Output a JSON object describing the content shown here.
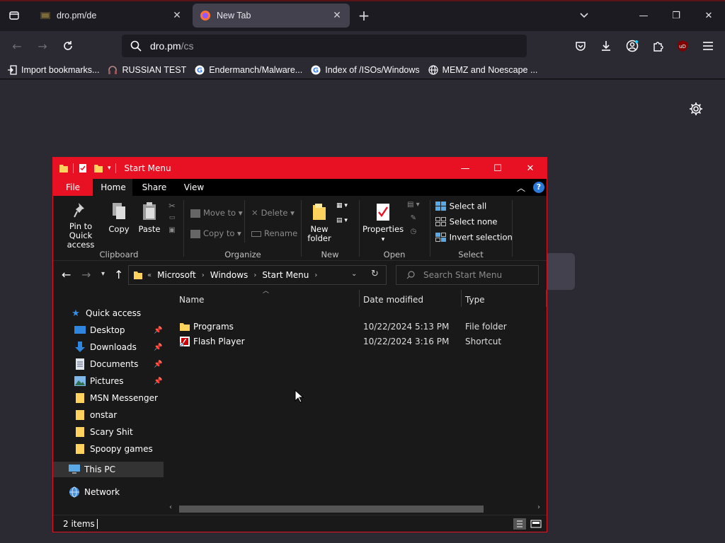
{
  "browser": {
    "tabs": [
      {
        "title": "dro.pm/de",
        "active": false
      },
      {
        "title": "New Tab",
        "active": true
      }
    ],
    "url": {
      "host": "dro.pm",
      "path": "/cs"
    },
    "bookmarks": [
      {
        "label": "Import bookmarks...",
        "icon": "import-icon"
      },
      {
        "label": "RUSSIAN TEST",
        "icon": "headset-icon"
      },
      {
        "label": "Endermanch/Malware...",
        "icon": "google-icon"
      },
      {
        "label": "Index of /ISOs/Windows",
        "icon": "google-icon"
      },
      {
        "label": "MEMZ and Noescape ...",
        "icon": "globe-icon"
      }
    ],
    "accent": "#e81123"
  },
  "explorer": {
    "title": "Start Menu",
    "ribbon_tabs": [
      "File",
      "Home",
      "Share",
      "View"
    ],
    "ribbon": {
      "pin": "Pin to Quick access",
      "pin_l1": "Pin to Quick",
      "pin_l2": "access",
      "copy": "Copy",
      "paste": "Paste",
      "move_to": "Move to",
      "copy_to": "Copy to",
      "delete": "Delete",
      "rename": "Rename",
      "new_folder_l1": "New",
      "new_folder_l2": "folder",
      "properties": "Properties",
      "select_all": "Select all",
      "select_none": "Select none",
      "invert_selection": "Invert selection",
      "groups": [
        "Clipboard",
        "Organize",
        "New",
        "Open",
        "Select"
      ]
    },
    "address": {
      "prefix": "«",
      "segments": [
        "Microsoft",
        "Windows",
        "Start Menu"
      ]
    },
    "search_placeholder": "Search Start Menu",
    "nav": {
      "quick_access": "Quick access",
      "items": [
        {
          "label": "Desktop",
          "pinned": true
        },
        {
          "label": "Downloads",
          "pinned": true
        },
        {
          "label": "Documents",
          "pinned": true
        },
        {
          "label": "Pictures",
          "pinned": true
        },
        {
          "label": "MSN Messenger",
          "pinned": false
        },
        {
          "label": "onstar",
          "pinned": false
        },
        {
          "label": "Scary Shit",
          "pinned": false
        },
        {
          "label": "Spoopy games",
          "pinned": false
        }
      ],
      "this_pc": "This PC",
      "network": "Network"
    },
    "columns": [
      "Name",
      "Date modified",
      "Type"
    ],
    "files": [
      {
        "name": "Programs",
        "date": "10/22/2024 5:13 PM",
        "type": "File folder"
      },
      {
        "name": "Flash Player",
        "date": "10/22/2024 3:16 PM",
        "type": "Shortcut"
      }
    ],
    "status": "2 items"
  }
}
